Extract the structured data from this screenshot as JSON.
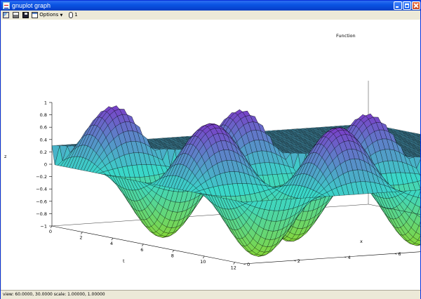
{
  "window": {
    "title": "gnuplot graph"
  },
  "toolbar": {
    "options_label": "Options",
    "dropdown_glyph": "▼",
    "mouse_label": "1",
    "icons": [
      "copy-icon",
      "print-icon",
      "save-icon",
      "options-icon",
      "mouse-icon"
    ]
  },
  "plot": {
    "legend_label": "Function",
    "z_axis_label": "z",
    "x_axis_label": "x",
    "t_axis_label": "t",
    "z_ticks": [
      "1",
      "0.8",
      "0.6",
      "0.4",
      "0.2",
      "0",
      "−0.2",
      "−0.4",
      "−0.6",
      "−0.8",
      "−1"
    ],
    "t_ticks": [
      "0",
      "2",
      "4",
      "6",
      "8",
      "10",
      "12"
    ],
    "x_ticks": [
      "0",
      "2",
      "4",
      "6",
      "8",
      "10",
      "12"
    ],
    "colors": {
      "high": "#7a3cc8",
      "mid": "#3ad6c8",
      "low": "#86d636",
      "mesh": "#000000"
    }
  },
  "status": {
    "text": "view: 60.0000, 30.0000   scale: 1.00000, 1.00000"
  }
}
